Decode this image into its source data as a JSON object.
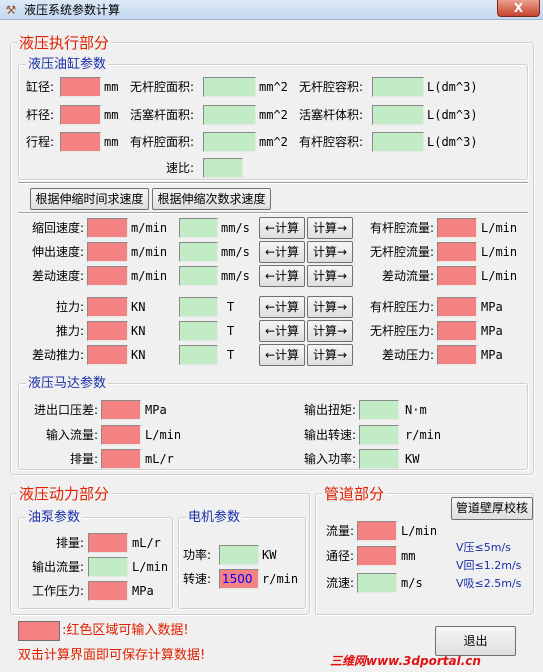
{
  "window": {
    "title": "液压系统参数计算",
    "close": "X",
    "app_icon": "hydraulic-app-icon"
  },
  "exec": {
    "title": "液压执行部分",
    "cyl_title": "液压油缸参数",
    "bore_label": "缸径:",
    "bore_unit": "mm",
    "rod_label": "杆径:",
    "rod_unit": "mm",
    "stroke_label": "行程:",
    "stroke_unit": "mm",
    "a1_label": "无杆腔面积:",
    "a1_unit": "mm^2",
    "a2_label": "活塞杆面积:",
    "a2_unit": "mm^2",
    "a3_label": "有杆腔面积:",
    "a3_unit": "mm^2",
    "v1_label": "无杆腔容积:",
    "v1_unit": "L(dm^3)",
    "v2_label": "活塞杆体积:",
    "v2_unit": "L(dm^3)",
    "v3_label": "有杆腔容积:",
    "v3_unit": "L(dm^3)",
    "ratio_label": "速比:",
    "btn_time": "根据伸缩时间求速度",
    "btn_count": "根据伸缩次数求速度",
    "speed_rows": [
      {
        "label": "缩回速度:",
        "unit1": "m/min",
        "unit2": "mm/s",
        "flow_label": "有杆腔流量:",
        "flow_unit": "L/min"
      },
      {
        "label": "伸出速度:",
        "unit1": "m/min",
        "unit2": "mm/s",
        "flow_label": "无杆腔流量:",
        "flow_unit": "L/min"
      },
      {
        "label": "差动速度:",
        "unit1": "m/min",
        "unit2": "mm/s",
        "flow_label": "差动流量:",
        "flow_unit": "L/min"
      }
    ],
    "force_rows": [
      {
        "label": "拉力:",
        "unit1": "KN",
        "unit2": "T",
        "p_label": "有杆腔压力:",
        "p_unit": "MPa"
      },
      {
        "label": "推力:",
        "unit1": "KN",
        "unit2": "T",
        "p_label": "无杆腔压力:",
        "p_unit": "MPa"
      },
      {
        "label": "差动推力:",
        "unit1": "KN",
        "unit2": "T",
        "p_label": "差动压力:",
        "p_unit": "MPa"
      }
    ],
    "calc_left": "←计算",
    "calc_right": "计算→"
  },
  "motor": {
    "title": "液压马达参数",
    "dp_label": "进出口压差:",
    "dp_unit": "MPa",
    "flow_label": "输入流量:",
    "flow_unit": "L/min",
    "disp_label": "排量:",
    "disp_unit": "mL/r",
    "torque_label": "输出扭矩:",
    "torque_unit": "N·m",
    "speed_label": "输出转速:",
    "speed_unit": "r/min",
    "power_label": "输入功率:",
    "power_unit": "KW"
  },
  "power": {
    "title": "液压动力部分",
    "pump_title": "油泵参数",
    "disp_label": "排量:",
    "disp_unit": "mL/r",
    "flow_label": "输出流量:",
    "flow_unit": "L/min",
    "press_label": "工作压力:",
    "press_unit": "MPa",
    "motor_title": "电机参数",
    "kw_label": "功率:",
    "kw_unit": "KW",
    "rpm_label": "转速:",
    "rpm_value": "1500",
    "rpm_unit": "r/min"
  },
  "pipe": {
    "title": "管道部分",
    "check_btn": "管道壁厚校核",
    "flow_label": "流量:",
    "flow_unit": "L/min",
    "dia_label": "通径:",
    "dia_unit": "mm",
    "vel_label": "流速:",
    "vel_unit": "m/s",
    "notes": [
      "V压≤5m/s",
      "V回≤1.2m/s",
      "V吸≤2.5m/s"
    ]
  },
  "footer": {
    "legend_text": ":红色区域可输入数据!",
    "save_hint": "双击计算界面即可保存计算数据!",
    "exit": "退出",
    "watermark": "三维网www.3dportal.cn"
  },
  "colors": {
    "input": "#f58282",
    "output": "#c2ecc6",
    "title_red": "#e02000",
    "title_blue": "#1a2fa8"
  }
}
